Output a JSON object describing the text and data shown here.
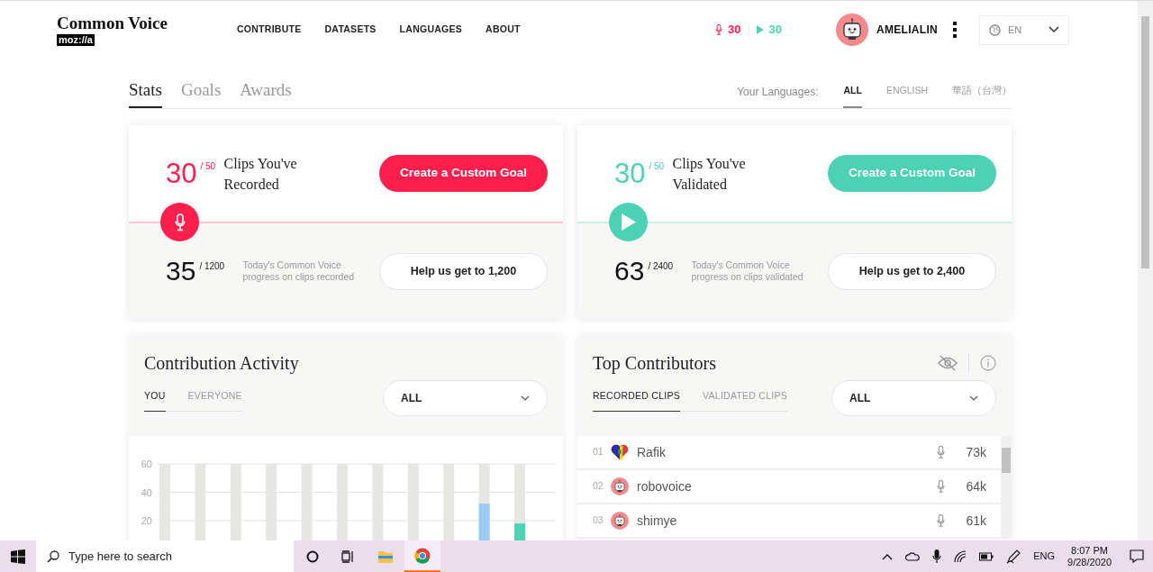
{
  "header": {
    "logo": {
      "title": "Common Voice",
      "badge": "moz://a"
    },
    "nav": [
      "CONTRIBUTE",
      "DATASETS",
      "LANGUAGES",
      "ABOUT"
    ],
    "counters": [
      {
        "kind": "record",
        "value": "30"
      },
      {
        "kind": "validate",
        "value": "30"
      }
    ],
    "user": {
      "name": "AMELIALIN"
    },
    "language": {
      "value": "EN"
    }
  },
  "tabs": [
    {
      "label": "Stats",
      "selected": true
    },
    {
      "label": "Goals",
      "selected": false
    },
    {
      "label": "Awards",
      "selected": false
    }
  ],
  "languages": {
    "label": "Your Languages:",
    "options": [
      {
        "label": "ALL",
        "selected": true
      },
      {
        "label": "ENGLISH",
        "selected": false
      },
      {
        "label": "華語（台灣）",
        "selected": false
      }
    ]
  },
  "goal_cards": [
    {
      "kind": "record",
      "count": "30",
      "total": "/ 50",
      "title": "Clips You've Recorded",
      "button": "Create a Custom Goal",
      "daily_count": "35",
      "daily_total": "/ 1200",
      "daily_text": "Today's Common Voice progress on clips recorded",
      "help_button": "Help us get to 1,200"
    },
    {
      "kind": "validate",
      "count": "30",
      "total": "/ 50",
      "title": "Clips You've Validated",
      "button": "Create a Custom Goal",
      "daily_count": "63",
      "daily_total": "/ 2400",
      "daily_text": "Today's Common Voice progress on clips validated",
      "help_button": "Help us get to 2,400"
    }
  ],
  "activity": {
    "title": "Contribution Activity",
    "tabs": [
      {
        "label": "YOU",
        "selected": true
      },
      {
        "label": "EVERYONE",
        "selected": false
      }
    ],
    "filter": "ALL",
    "chart_data": {
      "type": "bar",
      "ylim": [
        5,
        60
      ],
      "yticks": [
        20,
        40,
        60
      ],
      "series": [
        {
          "color": "#e6e6e2",
          "values": [
            60,
            60,
            60,
            60,
            60,
            60,
            60,
            60,
            60,
            60,
            60
          ]
        },
        {
          "color": "#9ccbf5",
          "values": [
            null,
            null,
            null,
            null,
            null,
            null,
            null,
            null,
            null,
            32,
            null
          ]
        },
        {
          "color": "#4fd1b4",
          "values": [
            null,
            null,
            null,
            null,
            null,
            null,
            null,
            null,
            null,
            null,
            18
          ]
        }
      ]
    }
  },
  "contributors": {
    "title": "Top Contributors",
    "tabs": [
      {
        "label": "RECORDED CLIPS",
        "selected": true
      },
      {
        "label": "VALIDATED CLIPS",
        "selected": false
      }
    ],
    "filter": "ALL",
    "rows": [
      {
        "kind": "custom",
        "rank": "01",
        "name": "Rafik",
        "count": "73k"
      },
      {
        "kind": "default",
        "rank": "02",
        "name": "robovoice",
        "count": "64k"
      },
      {
        "kind": "default",
        "rank": "03",
        "name": "shimye",
        "count": "61k"
      }
    ]
  },
  "taskbar": {
    "search_placeholder": "Type here to search",
    "language": "ENG",
    "time": "8:07 PM",
    "date": "9/28/2020"
  }
}
